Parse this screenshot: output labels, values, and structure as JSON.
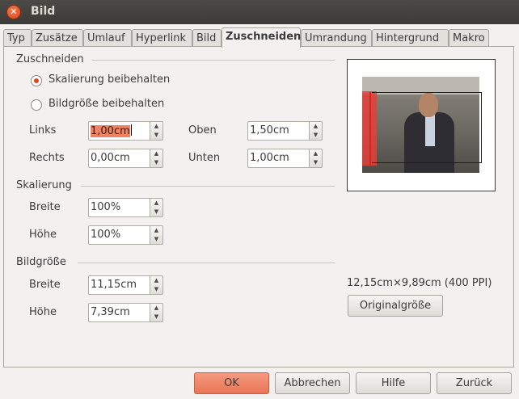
{
  "window": {
    "title": "Bild"
  },
  "tabs": [
    "Typ",
    "Zusätze",
    "Umlauf",
    "Hyperlink",
    "Bild",
    "Zuschneiden",
    "Umrandung",
    "Hintergrund",
    "Makro"
  ],
  "active_tab": "Zuschneiden",
  "crop": {
    "section_title": "Zuschneiden",
    "option_keep_scale": "Skalierung beibehalten",
    "option_keep_size": "Bildgröße beibehalten",
    "selected_option": "Skalierung beibehalten",
    "left_label": "Links",
    "left_value": "1,00cm",
    "right_label": "Rechts",
    "right_value": "0,00cm",
    "top_label": "Oben",
    "top_value": "1,50cm",
    "bottom_label": "Unten",
    "bottom_value": "1,00cm"
  },
  "scale": {
    "section_title": "Skalierung",
    "width_label": "Breite",
    "width_value": "100%",
    "height_label": "Höhe",
    "height_value": "100%"
  },
  "image_size": {
    "section_title": "Bildgröße",
    "width_label": "Breite",
    "width_value": "11,15cm",
    "height_label": "Höhe",
    "height_value": "7,39cm"
  },
  "preview": {
    "size_info": "12,15cm×9,89cm (400 PPI)",
    "original_size_button": "Originalgröße"
  },
  "footer": {
    "ok": "OK",
    "cancel": "Abbrechen",
    "help": "Hilfe",
    "reset": "Zurück"
  },
  "colors": {
    "accent": "#dd4814",
    "ok_button": "#ea7555",
    "selection": "#f08262"
  }
}
